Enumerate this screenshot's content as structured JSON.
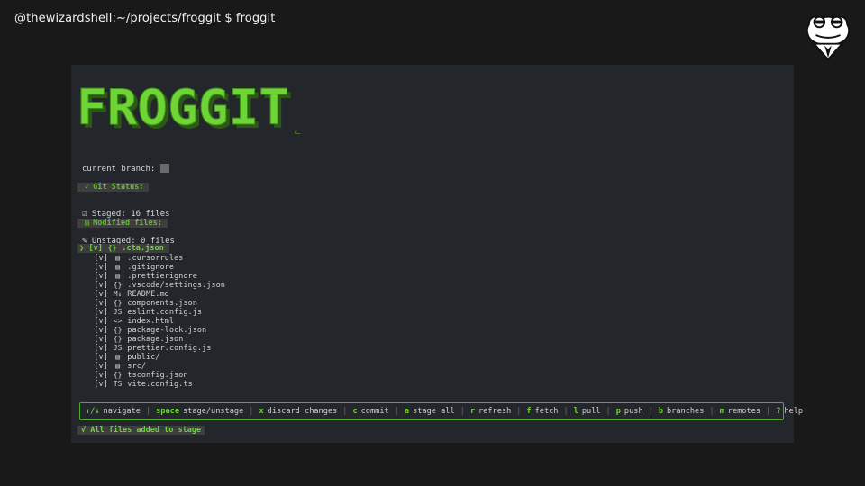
{
  "prompt": "@thewizardshell:~/projects/froggit $ froggit",
  "banner": {
    "title": "FROGGIT",
    "signature": "ᓚ"
  },
  "branch": {
    "label": "current branch:"
  },
  "git_status": {
    "header": "Git Status:",
    "staged": "Staged: 16 files",
    "unstaged": "Unstaged: 0 files"
  },
  "modified": {
    "header": "Modified files:"
  },
  "files": [
    {
      "check": "[v]",
      "icon": "{}",
      "name": ".cta.json",
      "selected": true
    },
    {
      "check": "[v]",
      "icon": "▤",
      "name": ".cursorrules"
    },
    {
      "check": "[v]",
      "icon": "▤",
      "name": ".gitignore"
    },
    {
      "check": "[v]",
      "icon": "▤",
      "name": ".prettierignore"
    },
    {
      "check": "[v]",
      "icon": "{}",
      "name": ".vscode/settings.json"
    },
    {
      "check": "[v]",
      "icon": "M↓",
      "name": "README.md"
    },
    {
      "check": "[v]",
      "icon": "{}",
      "name": "components.json"
    },
    {
      "check": "[v]",
      "icon": "JS",
      "name": "eslint.config.js"
    },
    {
      "check": "[v]",
      "icon": "<>",
      "name": "index.html"
    },
    {
      "check": "[v]",
      "icon": "{}",
      "name": "package-lock.json"
    },
    {
      "check": "[v]",
      "icon": "{}",
      "name": "package.json"
    },
    {
      "check": "[v]",
      "icon": "JS",
      "name": "prettier.config.js"
    },
    {
      "check": "[v]",
      "icon": "▤",
      "name": "public/"
    },
    {
      "check": "[v]",
      "icon": "▤",
      "name": "src/"
    },
    {
      "check": "[v]",
      "icon": "{}",
      "name": "tsconfig.json"
    },
    {
      "check": "[v]",
      "icon": "TS",
      "name": "vite.config.ts"
    }
  ],
  "help": [
    {
      "key": "↑/↓",
      "label": "navigate"
    },
    {
      "key": "space",
      "label": "stage/unstage"
    },
    {
      "key": "x",
      "label": "discard changes"
    },
    {
      "key": "c",
      "label": "commit"
    },
    {
      "key": "a",
      "label": "stage all"
    },
    {
      "key": "r",
      "label": "refresh"
    },
    {
      "key": "f",
      "label": "fetch"
    },
    {
      "key": "l",
      "label": "pull"
    },
    {
      "key": "p",
      "label": "push"
    },
    {
      "key": "b",
      "label": "branches"
    },
    {
      "key": "m",
      "label": "remotes"
    },
    {
      "key": "?",
      "label": "help"
    }
  ],
  "footer": "√ All files added to stage",
  "colors": {
    "accent": "#5fbf2a",
    "background": "#191919",
    "terminal": "#23262a"
  }
}
